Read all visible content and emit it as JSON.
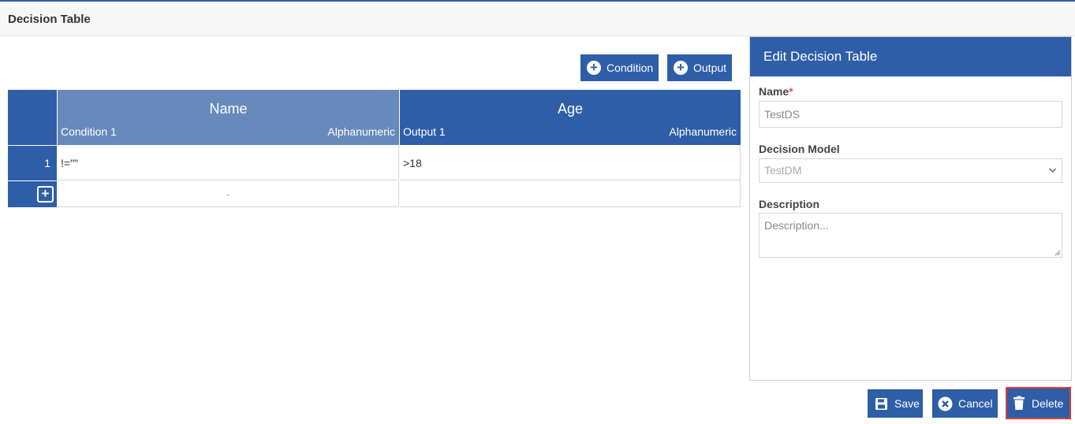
{
  "page": {
    "title": "Decision Table"
  },
  "toolbar": {
    "condition_label": "Condition",
    "output_label": "Output"
  },
  "table": {
    "columns": [
      {
        "title": "Name",
        "kind": "Condition 1",
        "type": "Alphanumeric"
      },
      {
        "title": "Age",
        "kind": "Output 1",
        "type": "Alphanumeric"
      }
    ],
    "rows": [
      {
        "index": "1",
        "cells": [
          "!=\"\"",
          ">18"
        ]
      }
    ],
    "add_row_placeholder": "-"
  },
  "panel": {
    "title": "Edit Decision Table",
    "name_label": "Name",
    "required_mark": "*",
    "name_value": "TestDS",
    "model_label": "Decision Model",
    "model_value": "TestDM",
    "description_label": "Description",
    "description_placeholder": "Description..."
  },
  "actions": {
    "save_label": "Save",
    "cancel_label": "Cancel",
    "delete_label": "Delete"
  },
  "colors": {
    "primary": "#2e5ea8",
    "header_light": "#6889bb",
    "highlight": "#e03a3a"
  }
}
